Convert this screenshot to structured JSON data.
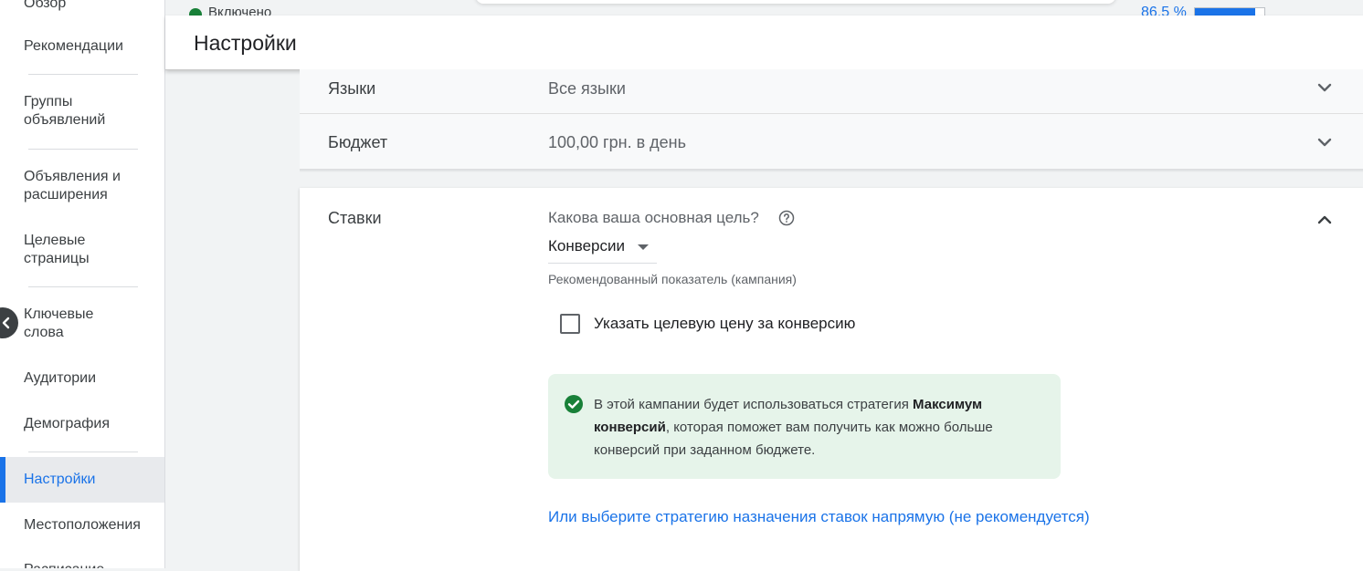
{
  "sidebar": {
    "items": [
      {
        "label": "Обзор"
      },
      {
        "label": "Рекомендации"
      },
      {
        "label": "Группы объявлений"
      },
      {
        "label": "Объявления и расширения"
      },
      {
        "label": "Целевые страницы"
      },
      {
        "label": "Ключевые слова"
      },
      {
        "label": "Аудитории"
      },
      {
        "label": "Демография"
      },
      {
        "label": "Настройки"
      },
      {
        "label": "Местоположения"
      },
      {
        "label": "Расписание"
      }
    ],
    "active_item": "Настройки"
  },
  "top_strip": {
    "status": "Включено",
    "status_color": "#188038",
    "percent": "86,5 %",
    "percent_value": 0.865
  },
  "header": {
    "title": "Настройки"
  },
  "settings_rows": [
    {
      "label": "Языки",
      "value": "Все языки"
    },
    {
      "label": "Бюджет",
      "value": "100,00 грн. в день"
    }
  ],
  "bids": {
    "label": "Ставки",
    "question": "Какова ваша основная цель?",
    "goal_selected": "Конверсии",
    "hint": "Рекомендованный показатель (кампания)",
    "checkbox_label": "Указать целевую цену за конверсию",
    "checkbox_checked": false,
    "info": {
      "part1": "В этой кампании будет использоваться стратегия ",
      "bold": "Максимум конверсий",
      "part2": ", которая поможет вам получить как можно больше конверсий при заданном бюджете."
    },
    "link": "Или выберите стратегию назначения ставок напрямую (не рекомендуется)"
  },
  "colors": {
    "accent": "#1a73e8",
    "success": "#188038",
    "info_background": "#e6f4ea"
  },
  "icons": {
    "collapse_sidebar": "chevron-left-icon",
    "row_expand": "chevron-down-icon",
    "card_collapse": "chevron-up-icon",
    "help": "help-circle-icon",
    "success": "check-circle-icon"
  }
}
